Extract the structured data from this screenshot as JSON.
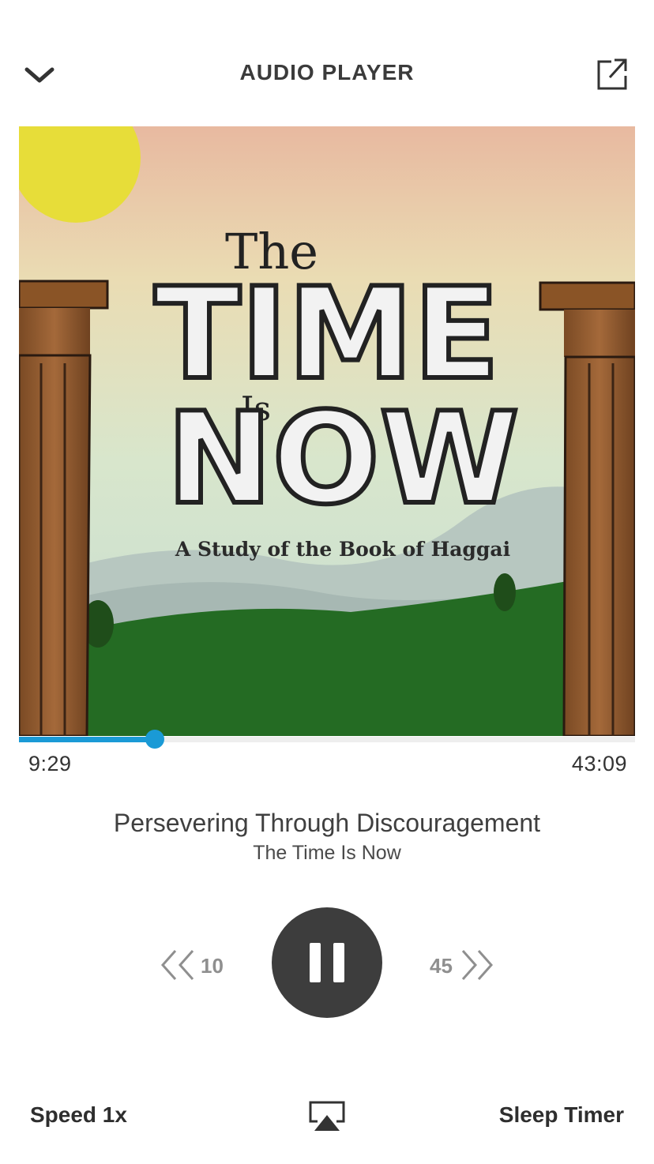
{
  "header": {
    "title": "AUDIO PLAYER",
    "collapse_icon": "chevron-down-icon",
    "share_icon": "external-share-icon"
  },
  "artwork": {
    "line1": "The",
    "line2": "TIME",
    "line3": "Is",
    "line4": "NOW",
    "subtitle": "A Study of the Book of Haggai"
  },
  "progress": {
    "elapsed": "9:29",
    "duration": "43:09",
    "fraction": 0.22,
    "color": "#1a9ad6"
  },
  "episode": {
    "title": "Persevering Through Discouragement",
    "series": "The Time Is Now"
  },
  "controls": {
    "rewind_seconds": "10",
    "forward_seconds": "45",
    "play_state": "playing",
    "pause_icon": "pause-icon"
  },
  "bottom": {
    "speed_label": "Speed 1x",
    "sleep_label": "Sleep Timer",
    "airplay_icon": "airplay-icon"
  }
}
